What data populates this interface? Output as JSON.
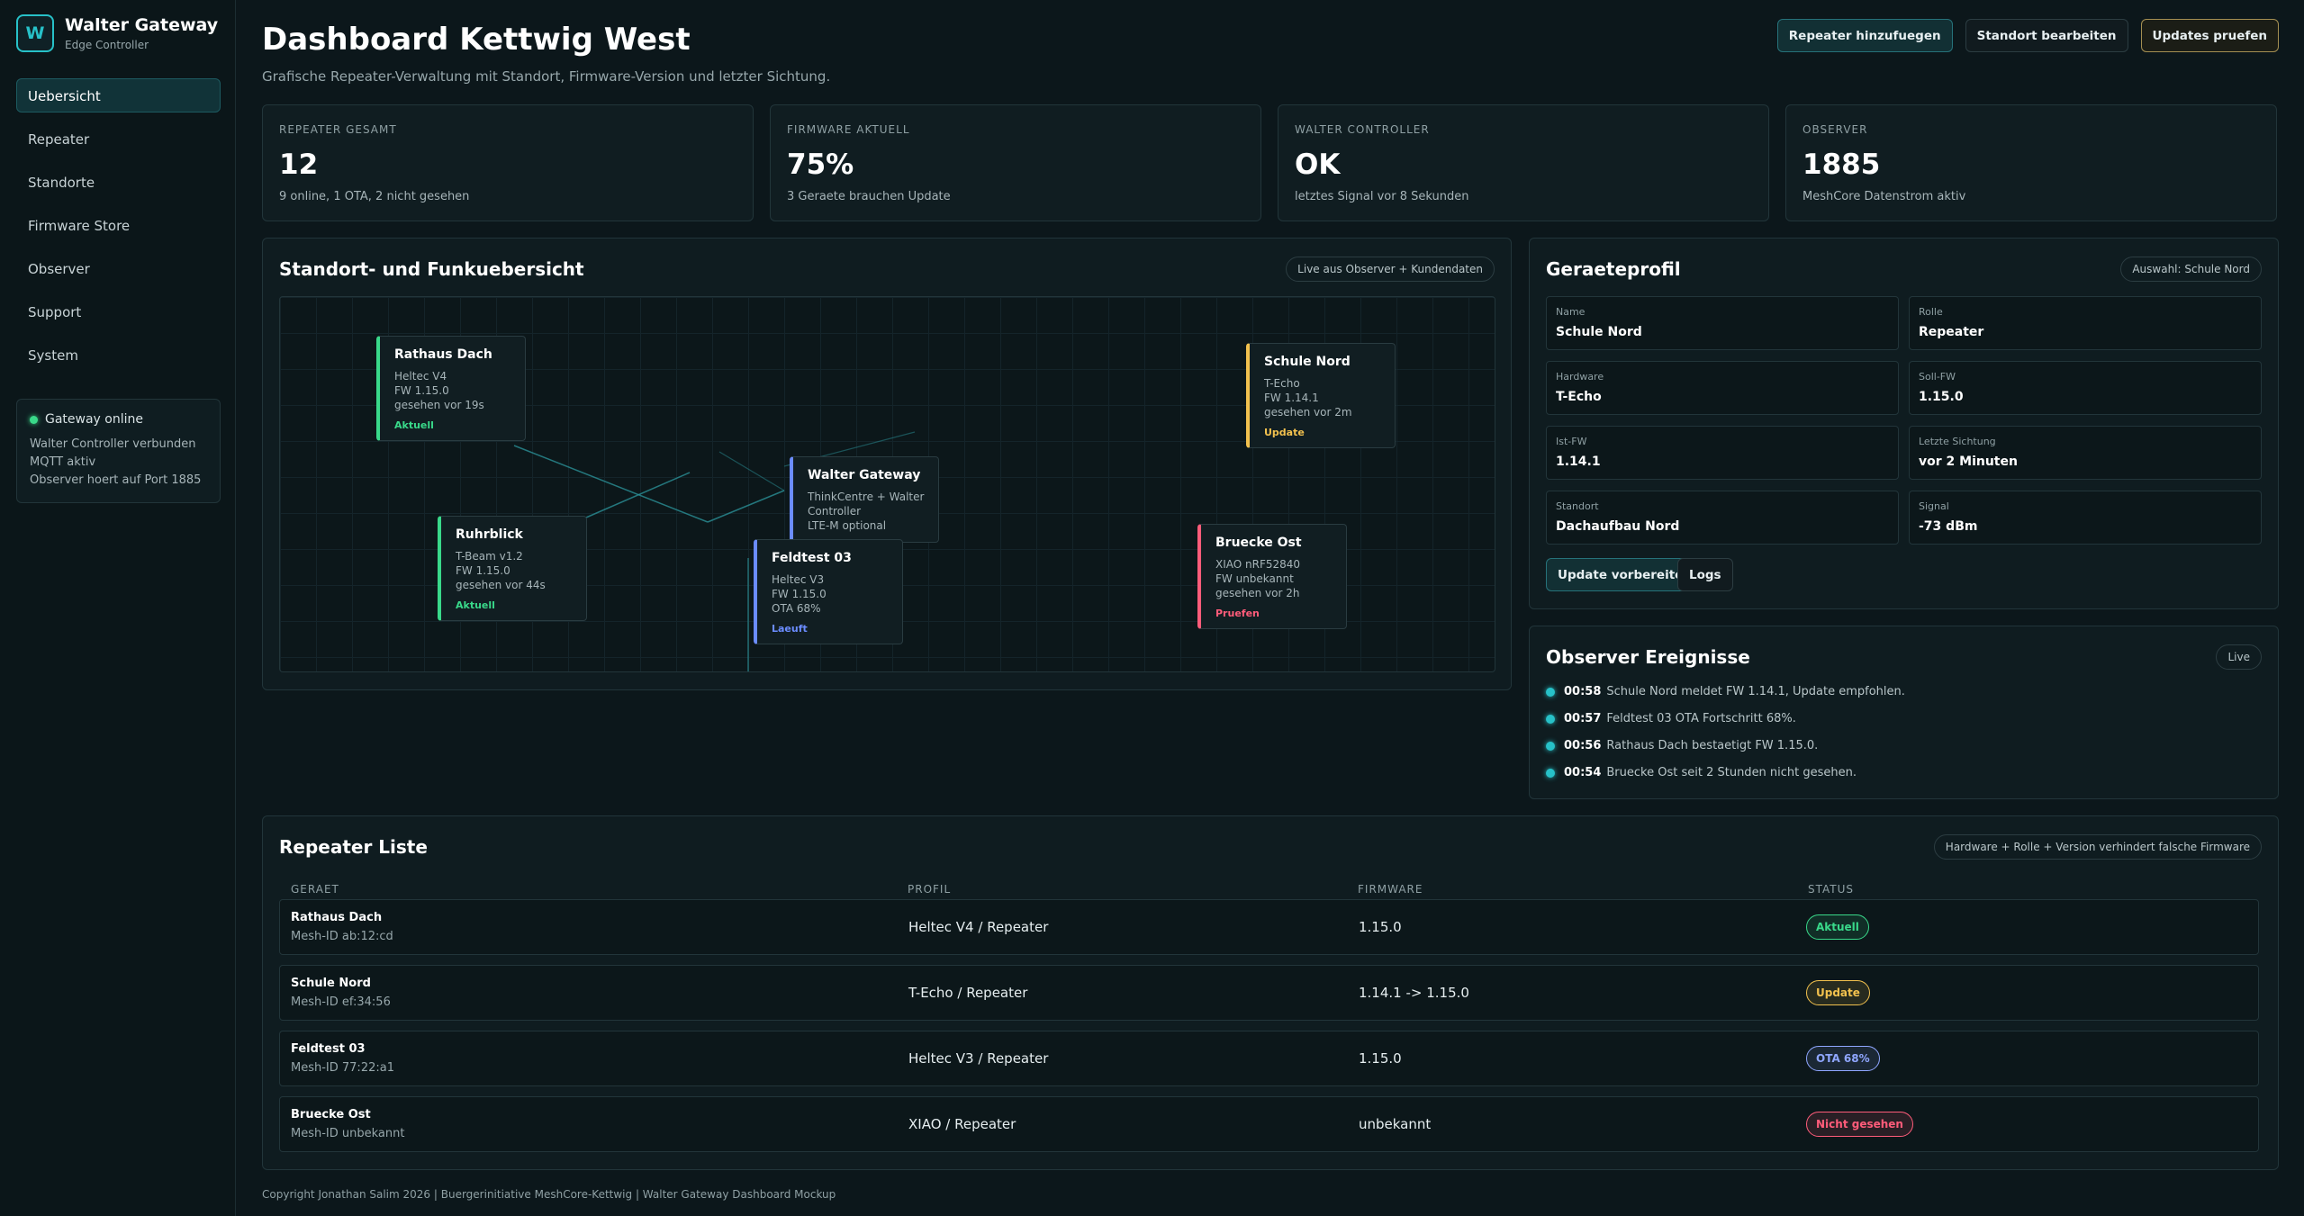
{
  "brand": {
    "logo": "W",
    "title": "Walter Gateway",
    "subtitle": "Edge Controller"
  },
  "nav": [
    {
      "label": "Uebersicht",
      "active": true
    },
    {
      "label": "Repeater"
    },
    {
      "label": "Standorte"
    },
    {
      "label": "Firmware Store"
    },
    {
      "label": "Observer"
    },
    {
      "label": "Support"
    },
    {
      "label": "System"
    }
  ],
  "gateway_status": {
    "title": "Gateway online",
    "lines": [
      "Walter Controller verbunden",
      "MQTT aktiv",
      "Observer hoert auf Port 1885"
    ]
  },
  "header": {
    "title": "Dashboard Kettwig West",
    "subtitle": "Grafische Repeater-Verwaltung mit Standort, Firmware-Version und letzter Sichtung.",
    "buttons": [
      "Repeater hinzufuegen",
      "Standort bearbeiten",
      "Updates pruefen"
    ]
  },
  "stats": [
    {
      "label": "REPEATER GESAMT",
      "value": "12",
      "note": "9 online, 1 OTA, 2 nicht gesehen"
    },
    {
      "label": "FIRMWARE AKTUELL",
      "value": "75%",
      "note": "3 Geraete brauchen Update"
    },
    {
      "label": "WALTER CONTROLLER",
      "value": "OK",
      "note": "letztes Signal vor 8 Sekunden"
    },
    {
      "label": "OBSERVER",
      "value": "1885",
      "note": "MeshCore Datenstrom aktiv"
    }
  ],
  "map_panel": {
    "title": "Standort- und Funkuebersicht",
    "pill": "Live aus Observer + Kundendaten",
    "nodes": [
      {
        "title": "Rathaus Dach",
        "lines": [
          "Heltec V4",
          "FW 1.15.0",
          "gesehen vor 19s"
        ],
        "status": "Aktuell",
        "color": "#39d98a"
      },
      {
        "title": "Ruhrblick",
        "lines": [
          "T-Beam v1.2",
          "FW 1.15.0",
          "gesehen vor 44s"
        ],
        "status": "Aktuell",
        "color": "#39d98a"
      },
      {
        "title": "Walter Gateway",
        "lines": [
          "ThinkCentre + Walter",
          "Controller",
          "LTE-M optional"
        ],
        "status": "",
        "color": "#6b8cff"
      },
      {
        "title": "Feldtest 03",
        "lines": [
          "Heltec V3",
          "FW 1.15.0",
          "OTA 68%"
        ],
        "status": "Laeuft",
        "color": "#6b8cff"
      },
      {
        "title": "Schule Nord",
        "lines": [
          "T-Echo",
          "FW 1.14.1",
          "gesehen vor 2m"
        ],
        "status": "Update",
        "color": "#f2c14e"
      },
      {
        "title": "Bruecke Ost",
        "lines": [
          "XIAO nRF52840",
          "FW unbekannt",
          "gesehen vor 2h"
        ],
        "status": "Pruefen",
        "color": "#ff5c7a"
      }
    ]
  },
  "profile": {
    "title": "Geraeteprofil",
    "pill": "Auswahl: Schule Nord",
    "fields": [
      {
        "label": "Name",
        "value": "Schule Nord"
      },
      {
        "label": "Rolle",
        "value": "Repeater"
      },
      {
        "label": "Hardware",
        "value": "T-Echo"
      },
      {
        "label": "Soll-FW",
        "value": "1.15.0"
      },
      {
        "label": "Ist-FW",
        "value": "1.14.1"
      },
      {
        "label": "Letzte Sichtung",
        "value": "vor 2 Minuten"
      },
      {
        "label": "Standort",
        "value": "Dachaufbau Nord"
      },
      {
        "label": "Signal",
        "value": "-73 dBm"
      }
    ],
    "buttons": [
      "Update vorbereiten",
      "Logs"
    ]
  },
  "events": {
    "title": "Observer Ereignisse",
    "pill": "Live",
    "items": [
      {
        "time": "00:58",
        "text": "Schule Nord meldet FW 1.14.1, Update empfohlen."
      },
      {
        "time": "00:57",
        "text": "Feldtest 03 OTA Fortschritt 68%."
      },
      {
        "time": "00:56",
        "text": "Rathaus Dach bestaetigt FW 1.15.0."
      },
      {
        "time": "00:54",
        "text": "Bruecke Ost seit 2 Stunden nicht gesehen."
      }
    ]
  },
  "table": {
    "title": "Repeater Liste",
    "pill": "Hardware + Rolle + Version verhindert falsche Firmware",
    "headers": [
      "GERAET",
      "PROFIL",
      "FIRMWARE",
      "STATUS"
    ],
    "rows": [
      {
        "name": "Rathaus Dach",
        "id": "Mesh-ID ab:12:cd",
        "profile": "Heltec V4 / Repeater",
        "firmware": "1.15.0",
        "status": "Aktuell",
        "color": "#39d98a"
      },
      {
        "name": "Schule Nord",
        "id": "Mesh-ID ef:34:56",
        "profile": "T-Echo / Repeater",
        "firmware": "1.14.1 -> 1.15.0",
        "status": "Update",
        "color": "#f2c14e"
      },
      {
        "name": "Feldtest 03",
        "id": "Mesh-ID 77:22:a1",
        "profile": "Heltec V3 / Repeater",
        "firmware": "1.15.0",
        "status": "OTA 68%",
        "color": "#8fa6ff"
      },
      {
        "name": "Bruecke Ost",
        "id": "Mesh-ID unbekannt",
        "profile": "XIAO / Repeater",
        "firmware": "unbekannt",
        "status": "Nicht gesehen",
        "color": "#ff5c7a"
      }
    ]
  },
  "footer": "Copyright Jonathan Salim 2026 | Buergerinitiative MeshCore-Kettwig | Walter Gateway Dashboard Mockup"
}
